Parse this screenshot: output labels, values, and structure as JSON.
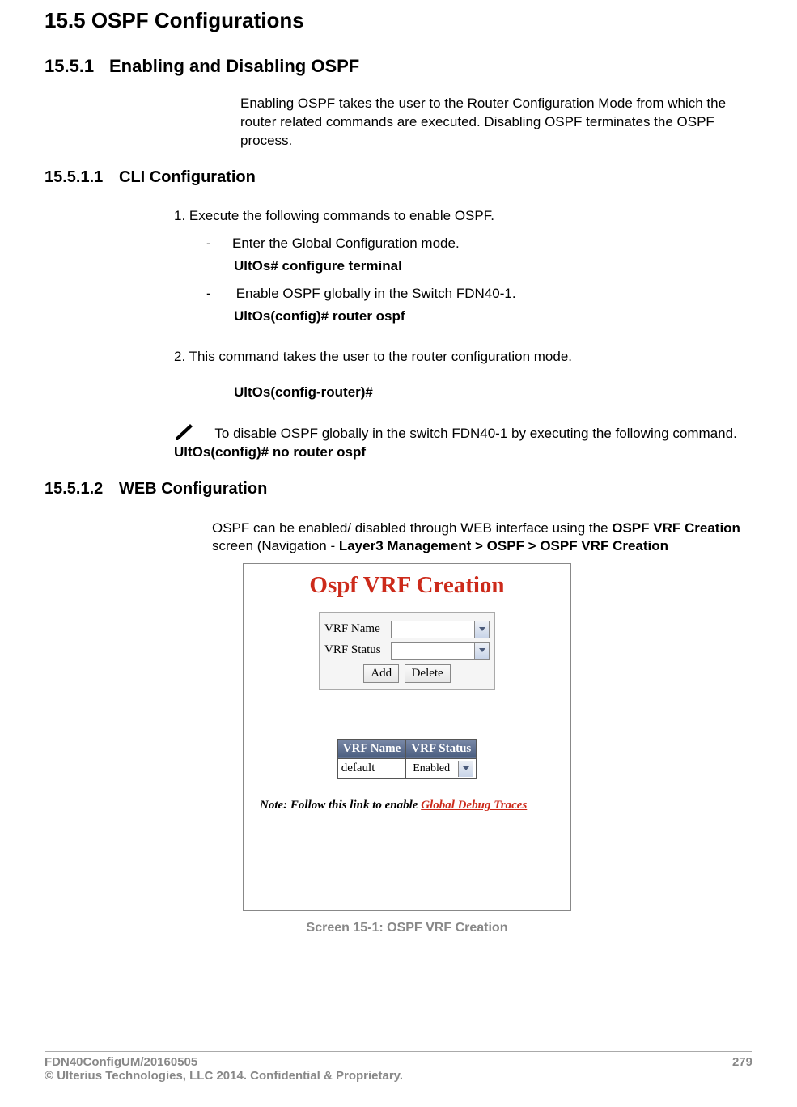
{
  "headings": {
    "h1": "15.5 OSPF Configurations",
    "h2_num": "15.5.1",
    "h2_text": "Enabling and Disabling OSPF",
    "h3a_num": "15.5.1.1",
    "h3a_text": "CLI Configuration",
    "h3b_num": "15.5.1.2",
    "h3b_text": "WEB Configuration"
  },
  "paras": {
    "intro": "Enabling OSPF takes the user to the Router Configuration Mode from which the router related commands are executed. Disabling OSPF terminates the OSPF process.",
    "step1": "1. Execute the following commands to enable OSPF.",
    "bullet1": "Enter the Global Configuration mode.",
    "cmd1": "UltOs# configure terminal",
    "bullet2": " Enable OSPF globally in the Switch FDN40-1.",
    "cmd2": "UltOs(config)# router ospf",
    "step2": "2. This command takes the user to the router configuration mode.",
    "cmd3": "UltOs(config-router)#",
    "note_text": "To disable OSPF globally in the switch FDN40-1 by executing the following command. ",
    "note_cmd": "UltOs(config)# no router ospf",
    "web_text1": "OSPF can be enabled/ disabled through WEB interface using the ",
    "web_bold1": "OSPF VRF Creation",
    "web_text2": " screen (Navigation - ",
    "web_bold2": "Layer3 Management > OSPF > OSPF VRF Creation"
  },
  "screenshot": {
    "title": "Ospf VRF Creation",
    "label_vrf_name": "VRF Name",
    "label_vrf_status": "VRF Status",
    "btn_add": "Add",
    "btn_delete": "Delete",
    "th_name": "VRF Name",
    "th_status": "VRF Status",
    "cell_name": "default",
    "cell_status": "Enabled",
    "note_prefix": "Note: Follow this link to enable ",
    "note_link": "Global Debug Traces"
  },
  "caption": "Screen 15-1: OSPF VRF Creation",
  "footer": {
    "left1": "FDN40ConfigUM/20160505",
    "left2": "© Ulterius Technologies, LLC 2014. Confidential & Proprietary.",
    "page": "279"
  }
}
